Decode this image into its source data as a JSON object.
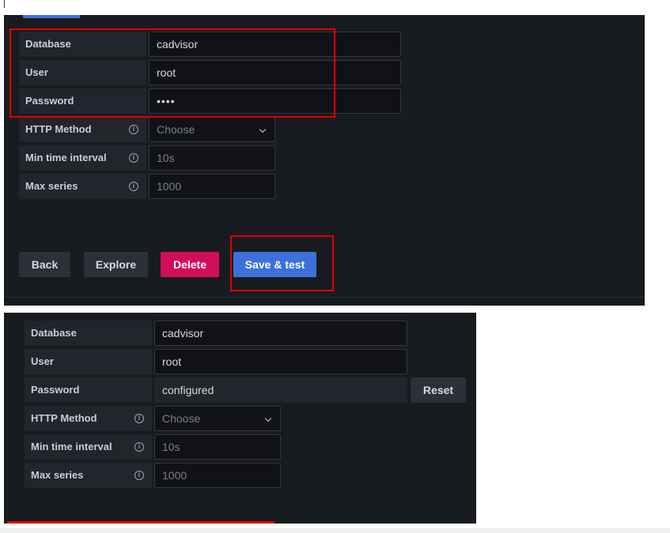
{
  "top_form": {
    "database": {
      "label": "Database",
      "value": "cadvisor"
    },
    "user": {
      "label": "User",
      "value": "root"
    },
    "password": {
      "label": "Password",
      "value": "••••"
    },
    "http_method": {
      "label": "HTTP Method",
      "placeholder": "Choose"
    },
    "min_time_interval": {
      "label": "Min time interval",
      "placeholder": "10s"
    },
    "max_series": {
      "label": "Max series",
      "placeholder": "1000"
    }
  },
  "buttons": {
    "back": "Back",
    "explore": "Explore",
    "delete": "Delete",
    "save_test": "Save & test"
  },
  "bottom_form": {
    "database": {
      "label": "Database",
      "value": "cadvisor"
    },
    "user": {
      "label": "User",
      "value": "root"
    },
    "password": {
      "label": "Password",
      "value": "configured",
      "reset_label": "Reset"
    },
    "http_method": {
      "label": "HTTP Method",
      "placeholder": "Choose"
    },
    "min_time_interval": {
      "label": "Min time interval",
      "placeholder": "10s"
    },
    "max_series": {
      "label": "Max series",
      "placeholder": "1000"
    }
  },
  "icons": {
    "info": "info-circle-icon",
    "dropdown": "chevron-down-icon"
  },
  "colors": {
    "panel_bg": "#181b1f",
    "label_bg": "#22252b",
    "input_bg": "#111217",
    "primary": "#3d71d9",
    "danger": "#d10e5c",
    "highlight": "#e00000"
  }
}
